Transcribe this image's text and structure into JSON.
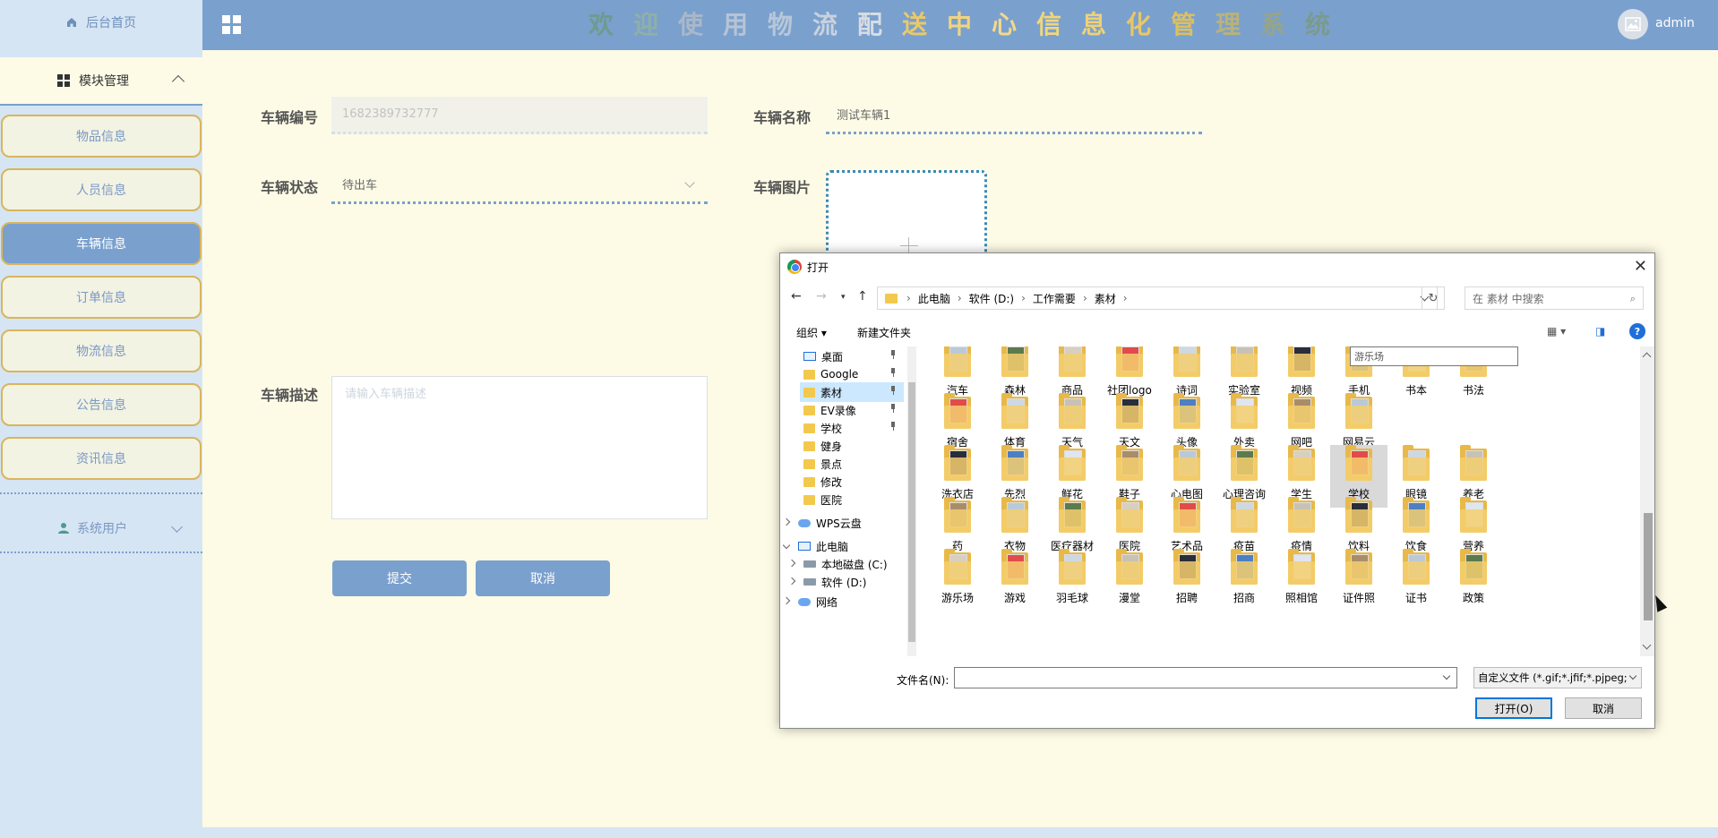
{
  "sidebar": {
    "home": "后台首页",
    "module": "模块管理",
    "items": [
      {
        "label": "物品信息"
      },
      {
        "label": "人员信息"
      },
      {
        "label": "车辆信息"
      },
      {
        "label": "订单信息"
      },
      {
        "label": "物流信息"
      },
      {
        "label": "公告信息"
      },
      {
        "label": "资讯信息"
      }
    ],
    "system_user": "系统用户"
  },
  "header": {
    "title_chars": [
      {
        "ch": "欢",
        "color": "#6f9a8f"
      },
      {
        "ch": "迎",
        "color": "#8fb0a6"
      },
      {
        "ch": "使",
        "color": "#a9b8c9"
      },
      {
        "ch": "用",
        "color": "#b7c4d4"
      },
      {
        "ch": "物",
        "color": "#b8c7d8"
      },
      {
        "ch": "流",
        "color": "#c8d2de"
      },
      {
        "ch": "配",
        "color": "#d8dce2"
      },
      {
        "ch": "送",
        "color": "#e8c96a"
      },
      {
        "ch": "中",
        "color": "#f1d480"
      },
      {
        "ch": "心",
        "color": "#f3d98a"
      },
      {
        "ch": "信",
        "color": "#f0d67c"
      },
      {
        "ch": "息",
        "color": "#eed177"
      },
      {
        "ch": "化",
        "color": "#e9c766"
      },
      {
        "ch": "管",
        "color": "#dcc05e"
      },
      {
        "ch": "理",
        "color": "#b9b27a"
      },
      {
        "ch": "系",
        "color": "#96a585"
      },
      {
        "ch": "统",
        "color": "#7a9b8d"
      }
    ],
    "username": "admin"
  },
  "form": {
    "vehicle_no_label": "车辆编号",
    "vehicle_no_value": "1682389732777",
    "vehicle_name_label": "车辆名称",
    "vehicle_name_value": "测试车辆1",
    "status_label": "车辆状态",
    "status_value": "待出车",
    "image_label": "车辆图片",
    "desc_label": "车辆描述",
    "desc_placeholder": "请输入车辆描述",
    "submit": "提交",
    "cancel": "取消"
  },
  "dialog": {
    "title": "打开",
    "breadcrumb": [
      "此电脑",
      "软件 (D:)",
      "工作需要",
      "素材"
    ],
    "search_placeholder": "在 素材 中搜索",
    "organize": "组织 ▾",
    "new_folder": "新建文件夹",
    "tree": [
      {
        "label": "桌面",
        "kind": "monitor",
        "pinned": true
      },
      {
        "label": "Google",
        "kind": "folder",
        "pinned": true
      },
      {
        "label": "素材",
        "kind": "folder",
        "pinned": true,
        "selected": true
      },
      {
        "label": "EV录像",
        "kind": "folder",
        "pinned": true
      },
      {
        "label": "学校",
        "kind": "folder",
        "pinned": true
      },
      {
        "label": "健身",
        "kind": "folder"
      },
      {
        "label": "景点",
        "kind": "folder"
      },
      {
        "label": "修改",
        "kind": "folder"
      },
      {
        "label": "医院",
        "kind": "folder"
      },
      {
        "label": "WPS云盘",
        "kind": "cloud"
      },
      {
        "label": "此电脑",
        "kind": "monitor"
      },
      {
        "label": "本地磁盘 (C:)",
        "kind": "drive"
      },
      {
        "label": "软件 (D:)",
        "kind": "drive"
      },
      {
        "label": "网络",
        "kind": "cloud"
      }
    ],
    "folders": [
      [
        "汽车",
        "森林",
        "商品",
        "社团logo",
        "诗词",
        "实验室",
        "视频",
        "手机",
        "书本",
        "书法"
      ],
      [
        "宿舍",
        "体育",
        "天气",
        "天文",
        "头像",
        "外卖",
        "网吧",
        "网易云",
        "",
        ""
      ],
      [
        "洗衣店",
        "先烈",
        "鲜花",
        "鞋子",
        "心电图",
        "心理咨询",
        "学生",
        "学校",
        "眼镜",
        "养老"
      ],
      [
        "药",
        "衣物",
        "医疗器材",
        "医院",
        "艺术品",
        "疫苗",
        "疫情",
        "饮料",
        "饮食",
        "营养"
      ],
      [
        "游乐场",
        "游戏",
        "羽毛球",
        "漫堂",
        "招聘",
        "招商",
        "照相馆",
        "证件照",
        "证书",
        "政策"
      ]
    ],
    "tooltip": "游乐场",
    "filename_label": "文件名(N):",
    "filetype": "自定义文件 (*.gif;*.jfif;*.pjpeg;",
    "open_btn": "打开(O)",
    "cancel_btn": "取消"
  }
}
